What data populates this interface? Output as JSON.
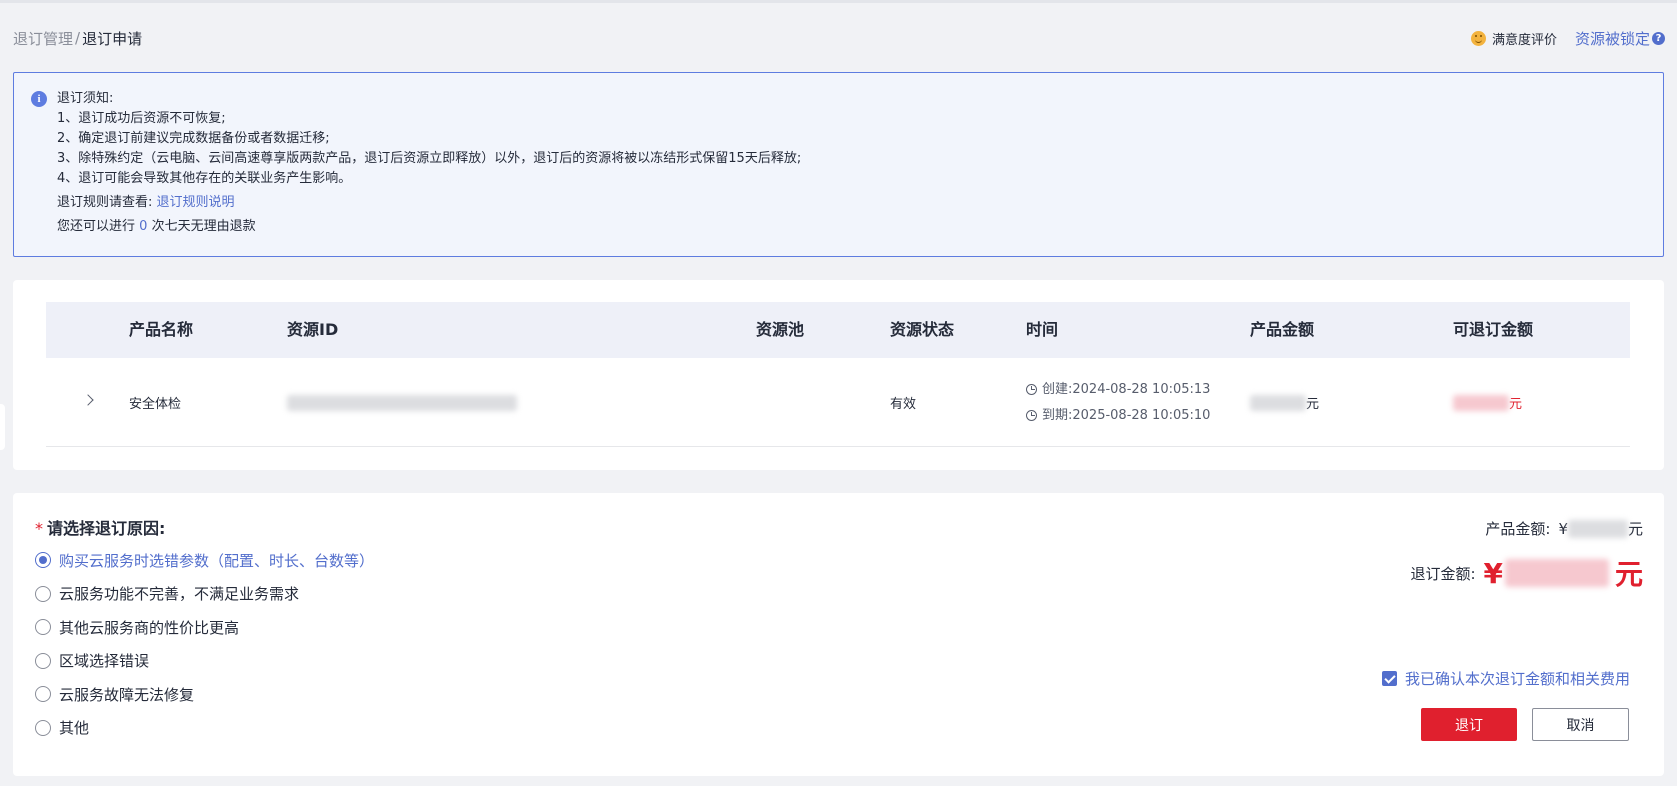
{
  "breadcrumb": {
    "parent": "退订管理",
    "separator": "/",
    "current": "退订申请"
  },
  "header": {
    "satisfaction": "满意度评价",
    "locked": "资源被锁定",
    "help_glyph": "?"
  },
  "notice": {
    "info_glyph": "i",
    "title": "退订须知:",
    "lines": [
      "1、退订成功后资源不可恢复;",
      "2、确定退订前建议完成数据备份或者数据迁移;",
      "3、除特殊约定（云电脑、云间高速尊享版两款产品，退订后资源立即释放）以外，退订后的资源将被以冻结形式保留15天后释放;",
      "4、退订可能会导致其他存在的关联业务产生影响。"
    ],
    "rules_prefix": "退订规则请查看:",
    "rules_link": "退订规则说明",
    "refund_prefix": "您还可以进行",
    "refund_count": "0",
    "refund_suffix": "次七天无理由退款"
  },
  "table": {
    "columns": [
      "产品名称",
      "资源ID",
      "资源池",
      "资源状态",
      "时间",
      "产品金额",
      "可退订金额"
    ],
    "rows": [
      {
        "product": "安全体检",
        "resource_id": "",
        "pool": "",
        "status": "有效",
        "created": "创建:2024-08-28 10:05:13",
        "expires": "到期:2025-08-28 10:05:10",
        "amount_unit": "元",
        "refundable_unit": "元"
      }
    ]
  },
  "form": {
    "reason_required_mark": "*",
    "reason_title": "请选择退订原因:",
    "reasons": [
      {
        "label": "购买云服务时选错参数（配置、时长、台数等）",
        "selected": true
      },
      {
        "label": "云服务功能不完善，不满足业务需求",
        "selected": false
      },
      {
        "label": "其他云服务商的性价比更高",
        "selected": false
      },
      {
        "label": "区域选择错误",
        "selected": false
      },
      {
        "label": "云服务故障无法修复",
        "selected": false
      },
      {
        "label": "其他",
        "selected": false
      }
    ],
    "product_amount_label": "产品金额:",
    "product_amount_currency": "¥",
    "product_amount_unit": "元",
    "refund_amount_label": "退订金额:",
    "refund_amount_currency": "¥",
    "refund_amount_unit": "元",
    "confirm_label": "我已确认本次退订金额和相关费用",
    "confirm_checked": true,
    "submit_label": "退订",
    "cancel_label": "取消"
  },
  "colors": {
    "accent": "#526ecc",
    "danger": "#e0202e",
    "notice_bg": "#f2f5fc",
    "table_header_bg": "#eef0f8"
  }
}
